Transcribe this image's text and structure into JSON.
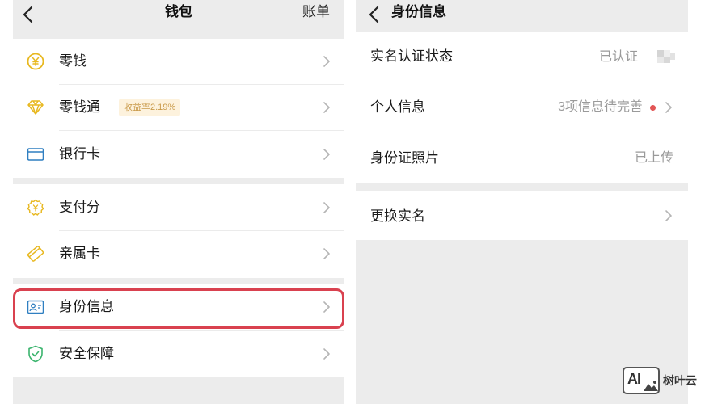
{
  "wallet": {
    "title": "钱包",
    "bill_label": "账单",
    "items": [
      {
        "label": "零钱",
        "icon": "coin-icon"
      },
      {
        "label": "零钱通",
        "icon": "diamond-icon",
        "badge": "收益率2.19%"
      },
      {
        "label": "银行卡",
        "icon": "bank-card-icon"
      },
      {
        "label": "支付分",
        "icon": "pay-score-icon"
      },
      {
        "label": "亲属卡",
        "icon": "family-card-icon"
      },
      {
        "label": "身份信息",
        "icon": "id-card-icon"
      },
      {
        "label": "安全保障",
        "icon": "shield-icon"
      }
    ],
    "highlighted_item": "身份信息"
  },
  "identity": {
    "title": "身份信息",
    "rows": [
      {
        "label": "实名认证状态",
        "value": "已认证"
      },
      {
        "label": "个人信息",
        "value": "3项信息待完善"
      },
      {
        "label": "身份证照片",
        "value": "已上传"
      },
      {
        "label": "更换实名"
      }
    ]
  },
  "watermark": {
    "logo_text": "AI",
    "text": "树叶云"
  },
  "colors": {
    "background": "#ececec",
    "card": "#ffffff",
    "accent_gold": "#e8b820",
    "accent_green": "#3bb46e",
    "accent_blue": "#2f7fc1",
    "highlight_red": "#d9414f",
    "badge_bg": "#fdf2dd",
    "badge_text": "#c99a4a"
  }
}
